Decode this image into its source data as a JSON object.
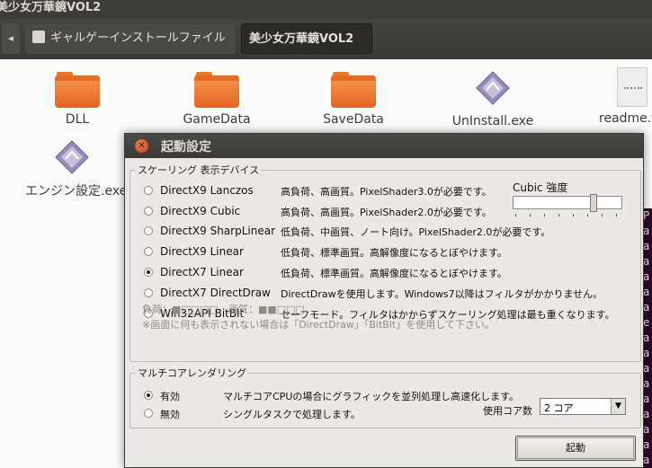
{
  "file_manager": {
    "window_title": "美少女万華鏡VOL2",
    "breadcrumbs": [
      "ギャルゲーインストールファイル",
      "美少女万華鏡VOL2"
    ],
    "files": [
      {
        "name": "DLL",
        "icon": "folder-icon"
      },
      {
        "name": "GameData",
        "icon": "folder-icon"
      },
      {
        "name": "SaveData",
        "icon": "folder-icon"
      },
      {
        "name": "UnInstall.exe",
        "icon": "executable-icon"
      },
      {
        "name": "readme.t",
        "icon": "text-file-icon"
      },
      {
        "name": "エンジン設定.exe",
        "icon": "executable-icon"
      }
    ],
    "terminal_fragment": [
      "P",
      "a",
      "a",
      "a",
      "a",
      "a",
      "a",
      "e",
      "a",
      "a",
      "a",
      "a",
      "a",
      "a",
      "a",
      "a",
      "a"
    ]
  },
  "dialog": {
    "title": "起動設定",
    "scaling": {
      "legend": "スケーリング 表示デバイス",
      "options": [
        {
          "name": "DirectX9 Lanczos",
          "desc": "高負荷、高画質。PixelShader3.0が必要です。",
          "selected": false
        },
        {
          "name": "DirectX9 Cubic",
          "desc": "高負荷、高画質。PixelShader2.0が必要です。",
          "selected": false
        },
        {
          "name": "DirectX9 SharpLinear",
          "desc": "低負荷、中画質、ノート向け。PixelShader2.0が必要です。",
          "selected": false
        },
        {
          "name": "DirectX9 Linear",
          "desc": "低負荷、標準画質。高解像度になるとぼやけます。",
          "selected": false
        },
        {
          "name": "DirectX7 Linear",
          "desc": "低負荷、標準画質。高解像度になるとぼやけます。",
          "selected": true
        },
        {
          "name": "DirectX7 DirectDraw",
          "desc": "DirectDrawを使用します。Windows7以降はフィルタがかかりません。",
          "selected": false
        },
        {
          "name": "Win32API BitBlt",
          "desc": "セーフモード。フィルタはかからずスケーリング処理は最も重くなります。",
          "selected": false
        }
      ],
      "cubic_label": "Cubic 強度",
      "cubic_strength": 0.75,
      "rating": "負荷：■□□□□　画質：■■□□□",
      "note": "※画面に何も表示されない場合は「DirectDraw」「BitBlt」を使用して下さい。"
    },
    "multicore": {
      "legend": "マルチコアレンダリング",
      "options": [
        {
          "name": "有効",
          "desc": "マルチコアCPUの場合にグラフィックを並列処理し高速化します。",
          "selected": true
        },
        {
          "name": "無効",
          "desc": "シングルタスクで処理します。",
          "selected": false
        }
      ],
      "core_label": "使用コア数",
      "core_value": "2 コア"
    },
    "launch_button": "起動"
  }
}
